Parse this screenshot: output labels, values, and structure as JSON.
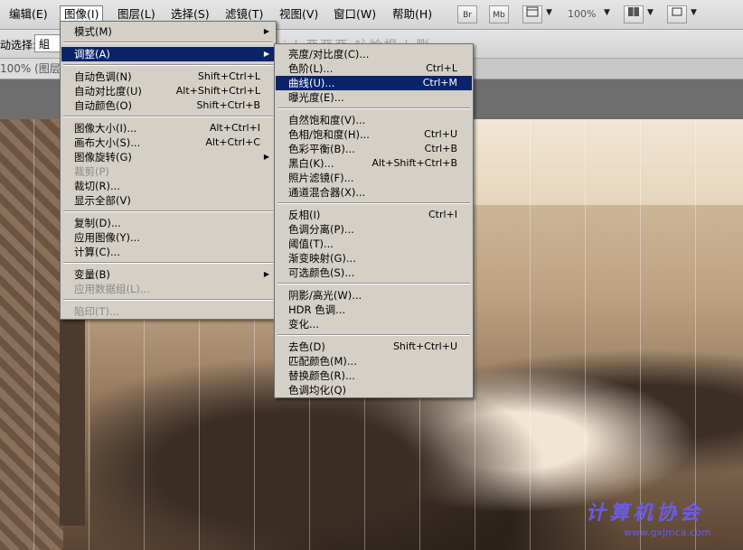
{
  "menubar": {
    "items": [
      "编辑(E)",
      "图像(I)",
      "图层(L)",
      "选择(S)",
      "滤镜(T)",
      "视图(V)",
      "窗口(W)",
      "帮助(H)"
    ],
    "bridge_label": "Br",
    "minibridge_label": "Mb",
    "zoom": "100%"
  },
  "options": {
    "auto_select_label": "动选择:",
    "auto_select_value": "組",
    "faded_icons": "| ⫶ | 亞亞亞 吣岭椙 | 删"
  },
  "doc_tab": {
    "label": "100% (图层"
  },
  "image_menu": {
    "items": [
      {
        "label": "模式(M)",
        "shortcut": "",
        "submenu": true
      },
      {
        "label": "调整(A)",
        "shortcut": "",
        "submenu": true,
        "highlighted": true
      },
      {
        "label": "自动色调(N)",
        "shortcut": "Shift+Ctrl+L"
      },
      {
        "label": "自动对比度(U)",
        "shortcut": "Alt+Shift+Ctrl+L"
      },
      {
        "label": "自动颜色(O)",
        "shortcut": "Shift+Ctrl+B"
      },
      {
        "label": "图像大小(I)...",
        "shortcut": "Alt+Ctrl+I"
      },
      {
        "label": "画布大小(S)...",
        "shortcut": "Alt+Ctrl+C"
      },
      {
        "label": "图像旋转(G)",
        "shortcut": "",
        "submenu": true
      },
      {
        "label": "裁剪(P)",
        "shortcut": "",
        "disabled": true
      },
      {
        "label": "裁切(R)...",
        "shortcut": ""
      },
      {
        "label": "显示全部(V)",
        "shortcut": ""
      },
      {
        "label": "复制(D)...",
        "shortcut": ""
      },
      {
        "label": "应用图像(Y)...",
        "shortcut": ""
      },
      {
        "label": "计算(C)...",
        "shortcut": ""
      },
      {
        "label": "变量(B)",
        "shortcut": "",
        "submenu": true
      },
      {
        "label": "应用数据组(L)...",
        "shortcut": "",
        "disabled": true
      },
      {
        "label": "陷印(T)...",
        "shortcut": "",
        "disabled": true
      }
    ]
  },
  "adjust_menu": {
    "items": [
      {
        "label": "亮度/对比度(C)...",
        "shortcut": ""
      },
      {
        "label": "色阶(L)...",
        "shortcut": "Ctrl+L"
      },
      {
        "label": "曲线(U)...",
        "shortcut": "Ctrl+M",
        "highlighted": true
      },
      {
        "label": "曝光度(E)...",
        "shortcut": ""
      },
      {
        "label": "自然饱和度(V)...",
        "shortcut": ""
      },
      {
        "label": "色相/饱和度(H)...",
        "shortcut": "Ctrl+U"
      },
      {
        "label": "色彩平衡(B)...",
        "shortcut": "Ctrl+B"
      },
      {
        "label": "黑白(K)...",
        "shortcut": "Alt+Shift+Ctrl+B"
      },
      {
        "label": "照片滤镜(F)...",
        "shortcut": ""
      },
      {
        "label": "通道混合器(X)...",
        "shortcut": ""
      },
      {
        "label": "反相(I)",
        "shortcut": "Ctrl+I"
      },
      {
        "label": "色调分离(P)...",
        "shortcut": ""
      },
      {
        "label": "阈值(T)...",
        "shortcut": ""
      },
      {
        "label": "渐变映射(G)...",
        "shortcut": ""
      },
      {
        "label": "可选颜色(S)...",
        "shortcut": ""
      },
      {
        "label": "阴影/高光(W)...",
        "shortcut": ""
      },
      {
        "label": "HDR 色调...",
        "shortcut": ""
      },
      {
        "label": "变化...",
        "shortcut": ""
      },
      {
        "label": "去色(D)",
        "shortcut": "Shift+Ctrl+U"
      },
      {
        "label": "匹配颜色(M)...",
        "shortcut": ""
      },
      {
        "label": "替换颜色(R)...",
        "shortcut": ""
      },
      {
        "label": "色调均化(Q)",
        "shortcut": ""
      }
    ]
  },
  "watermark": {
    "text": "计算机协会",
    "url": "www.gxjmca.com"
  }
}
